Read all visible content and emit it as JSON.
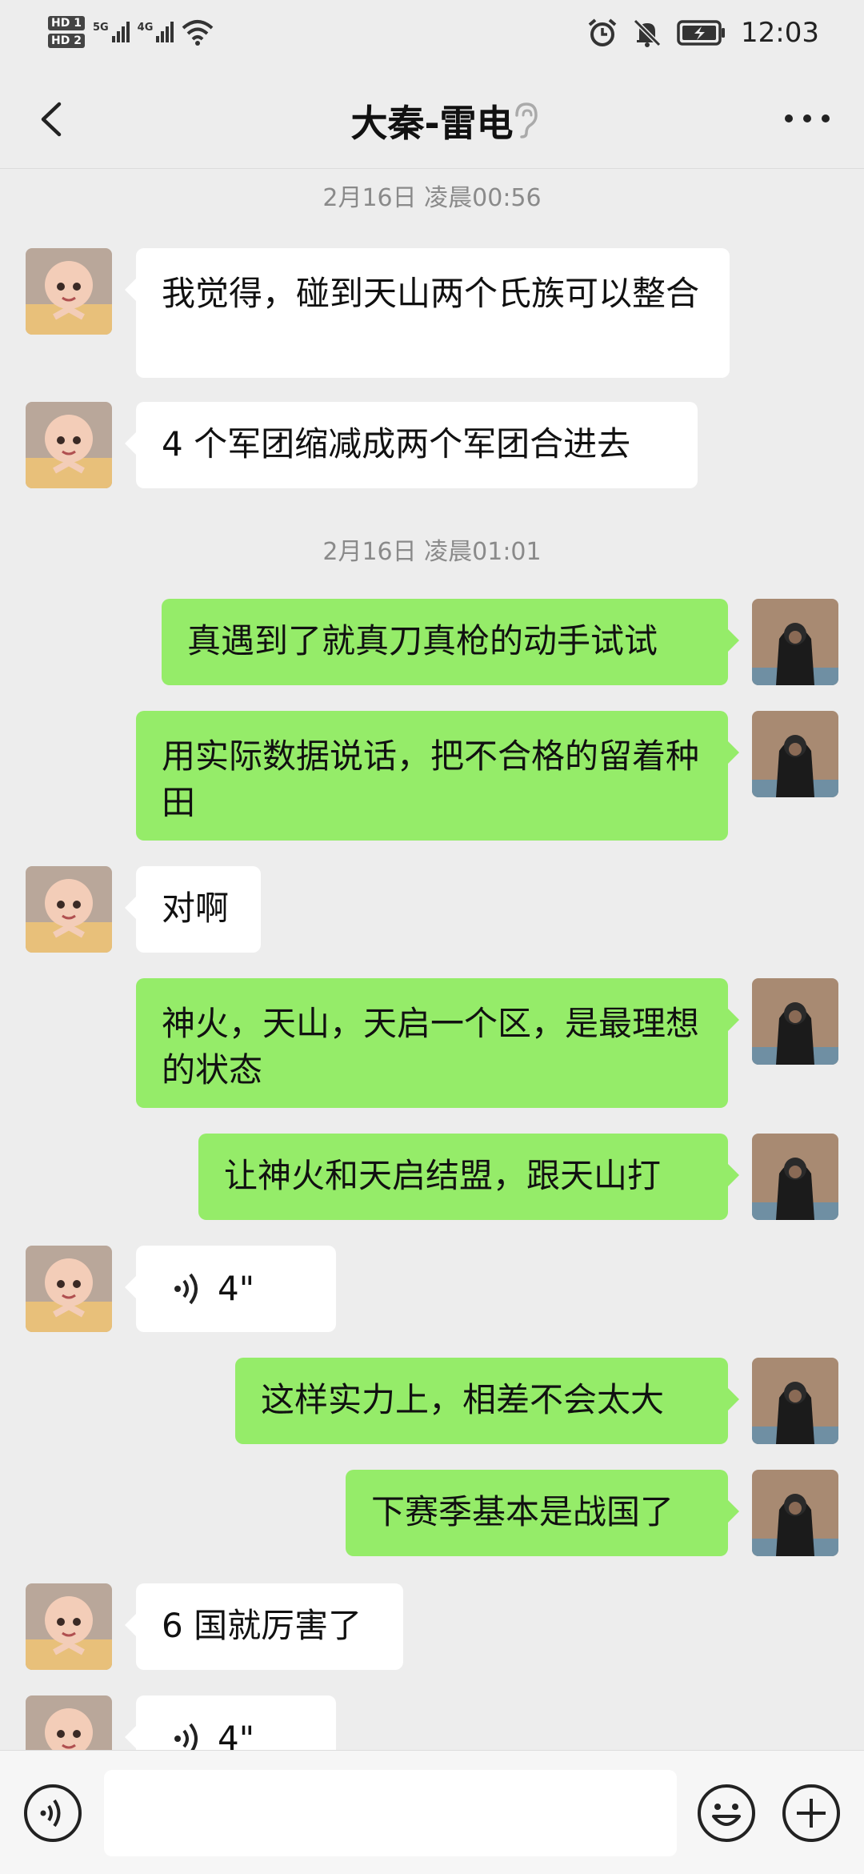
{
  "status_bar": {
    "sim1": "HD 1",
    "sim2": "HD 2",
    "net1": "5G",
    "net2": "4G",
    "time": "12:03"
  },
  "header": {
    "title": "大秦-雷电"
  },
  "colors": {
    "background": "#ededed",
    "incoming_bubble": "#ffffff",
    "outgoing_bubble": "#95ec69"
  },
  "messages": [
    {
      "type": "timestamp",
      "text": "2月16日 凌晨00:56"
    },
    {
      "type": "in",
      "text": "我觉得，碰到天山两个氏族可以整合"
    },
    {
      "type": "in",
      "text": "4 个军团缩减成两个军团合进去"
    },
    {
      "type": "timestamp",
      "text": "2月16日 凌晨01:01"
    },
    {
      "type": "out",
      "text": "真遇到了就真刀真枪的动手试试"
    },
    {
      "type": "out",
      "text": "用实际数据说话，把不合格的留着种田"
    },
    {
      "type": "in",
      "text": "对啊"
    },
    {
      "type": "out",
      "text": "神火，天山，天启一个区，是最理想的状态"
    },
    {
      "type": "out",
      "text": "让神火和天启结盟，跟天山打"
    },
    {
      "type": "in_voice",
      "text": "4\""
    },
    {
      "type": "out",
      "text": "这样实力上，相差不会太大"
    },
    {
      "type": "out",
      "text": "下赛季基本是战国了"
    },
    {
      "type": "in",
      "text": "6 国就厉害了"
    },
    {
      "type": "in_voice",
      "text": "4\""
    }
  ],
  "input_bar": {
    "voice_icon": "voice-input-icon",
    "emoji_icon": "emoji-icon",
    "plus_icon": "plus-icon",
    "value": ""
  }
}
